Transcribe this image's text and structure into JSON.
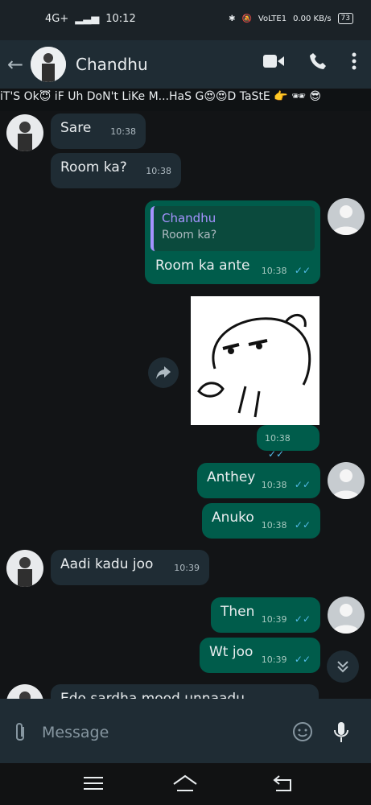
{
  "status_bar": {
    "network": "4G+",
    "time": "10:12",
    "volte": "VoLTE1",
    "speed": "0.00 KB/s",
    "battery": "73"
  },
  "header": {
    "contact_name": "Chandhu",
    "icons": [
      "back-arrow-icon",
      "video-call-icon",
      "phone-icon",
      "more-vert-icon"
    ]
  },
  "ticker": {
    "text": "iT'S Ok😇 iF Uh DoN't LiKe M...HaS G😍😍D TaStE 👉 🕶 😎"
  },
  "messages": [
    {
      "dir": "in",
      "text": "Sare",
      "time": "10:38"
    },
    {
      "dir": "in",
      "text": "Room ka?",
      "time": "10:38"
    },
    {
      "dir": "out",
      "quote_name": "Chandhu",
      "quote_text": "Room ka?",
      "text": "Room ka ante",
      "time": "10:38"
    },
    {
      "dir": "out",
      "type": "sticker",
      "time": "10:38"
    },
    {
      "dir": "out",
      "text": "Anthey",
      "time": "10:38"
    },
    {
      "dir": "out",
      "text": "Anuko",
      "time": "10:38"
    },
    {
      "dir": "in",
      "text": "Aadi kadu joo",
      "time": "10:39"
    },
    {
      "dir": "out",
      "text": "Then",
      "time": "10:39"
    },
    {
      "dir": "out",
      "text": "Wt joo",
      "time": "10:39"
    },
    {
      "dir": "in",
      "text": "Edo sardha mood unnaadu",
      "time": ""
    }
  ],
  "input": {
    "placeholder": "Message"
  },
  "nav": {
    "icons": [
      "menu-icon",
      "home-icon",
      "back-icon"
    ]
  }
}
